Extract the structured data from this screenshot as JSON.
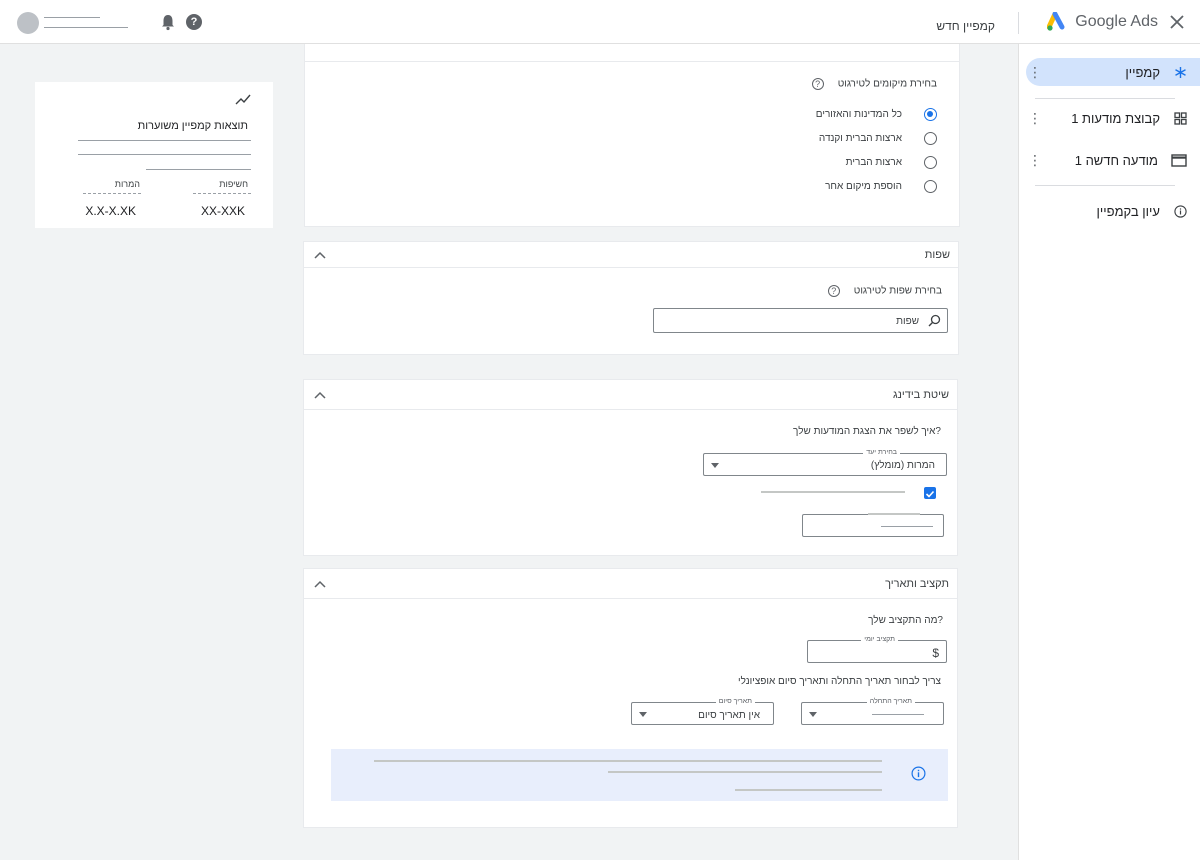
{
  "topbar": {
    "product_name": "Google Ads",
    "page_title": "קמפיין חדש",
    "help_glyph": "?"
  },
  "nav": {
    "items": [
      {
        "label": "קמפיין",
        "icon": "asterisk-icon",
        "active": true
      },
      {
        "label": "קבוצת מודעות 1",
        "icon": "grid-icon",
        "active": false
      },
      {
        "label": "מודעה חדשה 1",
        "icon": "browser-window-icon",
        "active": false
      },
      {
        "label": "עיון בקמפיין",
        "icon": "info-icon",
        "active": false
      }
    ],
    "kebab": "⋮"
  },
  "locations": {
    "heading": "בחירת מיקומים לטירגוט",
    "options": [
      {
        "label": "כל המדינות והאזורים",
        "selected": true
      },
      {
        "label": "ארצות הברית וקנדה",
        "selected": false
      },
      {
        "label": "ארצות הברית",
        "selected": false
      },
      {
        "label": "הוספת מיקום אחר",
        "selected": false
      }
    ]
  },
  "languages": {
    "title": "שפות",
    "heading": "בחירת שפות לטירגוט",
    "search_value": "שפות"
  },
  "bidding": {
    "title": "שיטת בידינג",
    "question": "?איך לשפר את הצגת המודעות שלך",
    "select_label": "בחירת יעד",
    "select_value": "המרות (מומלץ)",
    "checkbox_checked": true
  },
  "budget": {
    "title": "תקציב ותאריך",
    "question": "?מה התקציב שלך",
    "daily_label": "תקציב יומי",
    "currency": "$",
    "dates_question": "צריך לבחור תאריך התחלה ותאריך סיום אופציונלי",
    "start_label": "תאריך התחלה",
    "end_label": "תאריך סיום",
    "end_value": "אין תאריך סיום"
  },
  "summary": {
    "title": "תוצאות קמפיין משוערות",
    "impressions_label": "חשיפות",
    "impressions_value": "XX-XXK",
    "conversions_label": "המרות",
    "conversions_value": "X.X-X.XK"
  },
  "colors": {
    "accent": "#1a73e8",
    "active_nav": "#d2e3fc",
    "info_box": "#e8eefc",
    "background": "#f1f3f4"
  }
}
